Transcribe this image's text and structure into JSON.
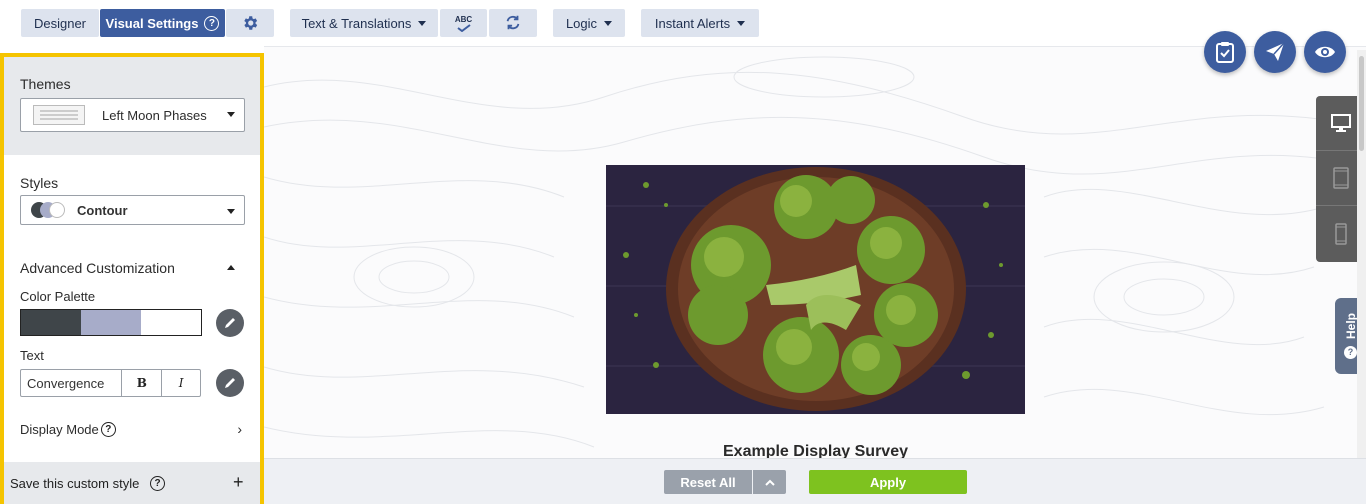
{
  "toolbar": {
    "designer": "Designer",
    "visual_settings": "Visual Settings",
    "text_translations": "Text & Translations",
    "spell_check_icon_text": "ABC",
    "logic": "Logic",
    "instant_alerts": "Instant Alerts"
  },
  "panel": {
    "themes_label": "Themes",
    "theme_value": "Left Moon Phases",
    "styles_label": "Styles",
    "style_value": "Contour",
    "advanced_label": "Advanced Customization",
    "palette_label": "Color Palette",
    "palette_colors": [
      "#3f4549",
      "#a7acc9",
      "#ffffff"
    ],
    "text_label": "Text",
    "text_font": "Convergence",
    "bold_label": "B",
    "italic_label": "I",
    "display_mode_label": "Display Mode",
    "save_label": "Save this custom style"
  },
  "canvas": {
    "survey_title": "Example Display Survey"
  },
  "side": {
    "help_label": "Help"
  },
  "bottom": {
    "reset_all": "Reset All",
    "apply": "Apply"
  },
  "colors": {
    "accent": "#3d5d9f",
    "highlight_border": "#f5c400",
    "apply_green": "#7ec21f"
  }
}
